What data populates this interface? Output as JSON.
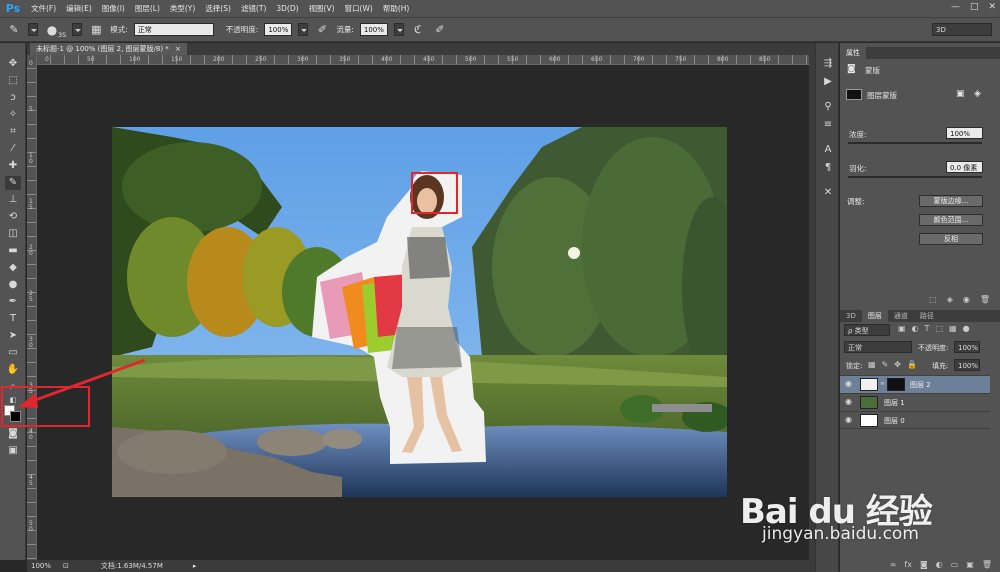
{
  "app": {
    "logo": "Ps"
  },
  "menus": [
    "文件(F)",
    "编辑(E)",
    "图像(I)",
    "图层(L)",
    "类型(Y)",
    "选择(S)",
    "滤镜(T)",
    "3D(D)",
    "视图(V)",
    "窗口(W)",
    "帮助(H)"
  ],
  "window_controls": {
    "minimize": "—",
    "maximize": "□",
    "close": "✕"
  },
  "options_bar": {
    "brush_size": "35",
    "mode_label": "模式:",
    "mode_value": "正常",
    "opacity_label": "不透明度:",
    "opacity_value": "100%",
    "flow_label": "流量:",
    "flow_value": "100%",
    "workspace": "3D"
  },
  "document": {
    "tab_title": "未标题-1 @ 100% (图层 2, 图层蒙版/8) *",
    "tab_close": "×",
    "zoom": "100%",
    "doc_size": "文档:1.63M/4.57M"
  },
  "rulers": {
    "top": [
      "0",
      "50",
      "100",
      "150",
      "200",
      "250",
      "300",
      "350",
      "400",
      "450",
      "500",
      "550",
      "600",
      "650",
      "700",
      "750",
      "800",
      "850"
    ],
    "left": [
      "0",
      "5",
      "1\n0",
      "1\n5",
      "2\n0",
      "2\n5",
      "3\n0",
      "3\n5",
      "4\n0",
      "4\n5",
      "5\n0"
    ]
  },
  "properties_panel": {
    "tab": "属性",
    "header": "蒙版",
    "mask_type": "图层蒙版",
    "density_label": "浓度:",
    "density_value": "100%",
    "feather_label": "羽化:",
    "feather_value": "0.0 像素",
    "adjust_label": "调整:",
    "btn_mask_edge": "蒙版边缘...",
    "btn_color_range": "颜色范围...",
    "btn_invert": "反相"
  },
  "layers_panel": {
    "tabs": [
      "3D",
      "图层",
      "通道",
      "路径"
    ],
    "kind_filter": "ρ 类型",
    "blend_mode": "正常",
    "opacity_label": "不透明度:",
    "opacity_value": "100%",
    "lock_label": "锁定:",
    "fill_label": "填充:",
    "fill_value": "100%",
    "layers": [
      {
        "name": "图层 2",
        "selected": true
      },
      {
        "name": "图层 1",
        "selected": false
      },
      {
        "name": "图层 0",
        "selected": false
      }
    ]
  },
  "watermark": {
    "logo": "Bai du 经验",
    "url": "jingyan.baidu.com"
  },
  "colors": {
    "chrome": "#535353",
    "canvas_bg": "#282828",
    "highlight_box": "#e0262e",
    "selected_layer": "#6e7f98"
  }
}
